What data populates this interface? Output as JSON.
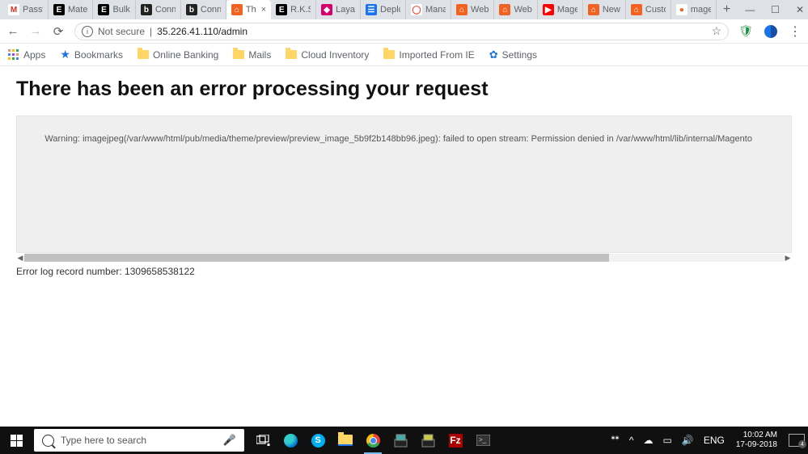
{
  "tabs": [
    {
      "label": "Passw",
      "fav": "M",
      "favColor": "#d93025",
      "favBg": "#fff"
    },
    {
      "label": "Mate",
      "fav": "E",
      "favColor": "#fff",
      "favBg": "#000"
    },
    {
      "label": "Bulk",
      "fav": "E",
      "favColor": "#fff",
      "favBg": "#000"
    },
    {
      "label": "Conn",
      "fav": "b",
      "favColor": "#fff",
      "favBg": "#222"
    },
    {
      "label": "Conn",
      "fav": "b",
      "favColor": "#fff",
      "favBg": "#222"
    },
    {
      "label": "Th",
      "fav": "⌂",
      "favColor": "#fff",
      "favBg": "#f26322",
      "active": true,
      "close": "×"
    },
    {
      "label": "R.K.S",
      "fav": "E",
      "favColor": "#fff",
      "favBg": "#000"
    },
    {
      "label": "Laya",
      "fav": "◆",
      "favColor": "#fff",
      "favBg": "#d6006c"
    },
    {
      "label": "Deplo",
      "fav": "☰",
      "favColor": "#fff",
      "favBg": "#1a73e8"
    },
    {
      "label": "Mana",
      "fav": "◯",
      "favColor": "#ea4335",
      "favBg": "#fff"
    },
    {
      "label": "Web",
      "fav": "⌂",
      "favColor": "#fff",
      "favBg": "#f26322"
    },
    {
      "label": "Web",
      "fav": "⌂",
      "favColor": "#fff",
      "favBg": "#f26322"
    },
    {
      "label": "Mage",
      "fav": "▶",
      "favColor": "#fff",
      "favBg": "#f00"
    },
    {
      "label": "New",
      "fav": "⌂",
      "favColor": "#fff",
      "favBg": "#f26322"
    },
    {
      "label": "Custo",
      "fav": "⌂",
      "favColor": "#fff",
      "favBg": "#f26322"
    },
    {
      "label": "mage",
      "fav": "●",
      "favColor": "#f26322",
      "favBg": "#fff"
    }
  ],
  "newTab": "+",
  "winCtrl": {
    "min": "—",
    "max": "☐",
    "close": "✕"
  },
  "nav": {
    "back": "←",
    "fwd": "→",
    "reload": "⟳"
  },
  "addr": {
    "secure": "Not secure",
    "sep": "|",
    "url": "35.226.41.110/admin",
    "info": "i",
    "star": "☆"
  },
  "bookmarks": {
    "apps": "Apps",
    "bmk": "Bookmarks",
    "items": [
      "Online Banking",
      "Mails",
      "Cloud Inventory",
      "Imported From IE"
    ],
    "settings": "Settings"
  },
  "page": {
    "title": "There has been an error processing your request",
    "warning": "Warning: imagejpeg(/var/www/html/pub/media/theme/preview/preview_image_5b9f2b148bb96.jpeg): failed to open stream: Permission denied in /var/www/html/lib/internal/Magento",
    "logLine": "Error log record number: 1309658538122"
  },
  "scroll": {
    "left": "◀",
    "right": "▶"
  },
  "taskbar": {
    "searchPlaceholder": "Type here to search",
    "mic": "🎤",
    "lang": "ENG",
    "time": "10:02 AM",
    "date": "17-09-2018",
    "skype": "S",
    "fz": "Fz",
    "person": "👤"
  }
}
